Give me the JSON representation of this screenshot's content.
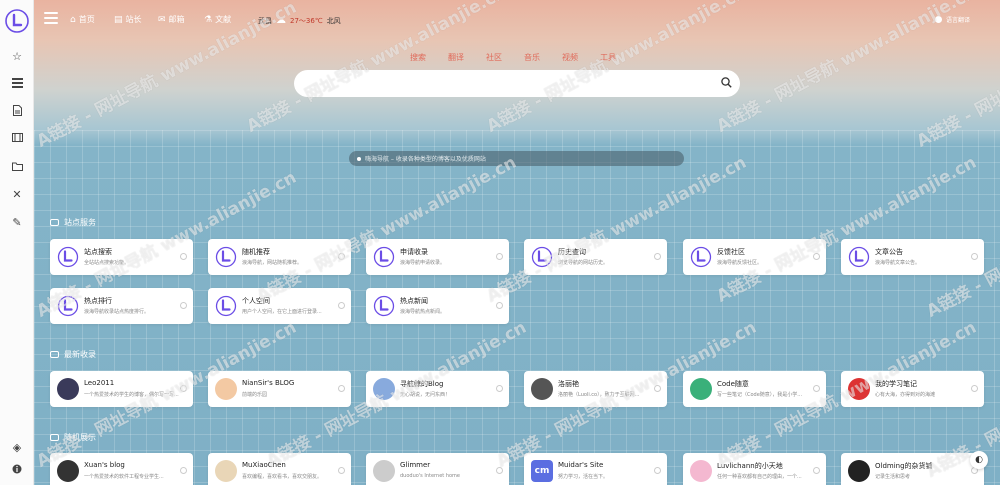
{
  "nav": {
    "items": [
      {
        "label": "首页",
        "icon": "home-icon"
      },
      {
        "label": "站长",
        "icon": "book-icon"
      },
      {
        "label": "邮箱",
        "icon": "mail-icon"
      },
      {
        "label": "文献",
        "icon": "flask-icon"
      }
    ],
    "weather": {
      "city": "武昌",
      "temp": "27～36℃",
      "wind": "北风"
    },
    "lang_label": "语言翻译"
  },
  "search": {
    "tabs": [
      "搜索",
      "翻译",
      "社区",
      "音乐",
      "视频",
      "工具"
    ],
    "placeholder": ""
  },
  "notice": "嗨海导航 – 收录各种类型的博客以及优质网站",
  "sections": [
    {
      "title": "站点服务",
      "cards": [
        {
          "title": "站点搜索",
          "desc": "全站站点搜索功能。"
        },
        {
          "title": "随机推荐",
          "desc": "浪海导航，网站随机推荐。"
        },
        {
          "title": "申请收录",
          "desc": "浪海导航申请收录。"
        },
        {
          "title": "历史查询",
          "desc": "浏览导航的网站历史。"
        },
        {
          "title": "反馈社区",
          "desc": "浪海导航反馈社区。"
        },
        {
          "title": "文章公告",
          "desc": "浪海导航文章公告。"
        },
        {
          "title": "热点排行",
          "desc": "浪海导航收录站点热度排行。"
        },
        {
          "title": "个人空间",
          "desc": "用户个人空间，在它上面进行登录..."
        },
        {
          "title": "热点新闻",
          "desc": "浪海导航热点新闻。"
        }
      ]
    },
    {
      "title": "最新收录",
      "cards": [
        {
          "title": "Leo2011",
          "desc": "一个热爱技术的学生的博客，偶尔写一写..."
        },
        {
          "title": "NianSir's BLOG",
          "desc": "前端的乐园"
        },
        {
          "title": "寻舷鲸的Blog",
          "desc": "无心胡说，无问东西！"
        },
        {
          "title": "洛丽艳",
          "desc": "洛丽艳（Luoli.co），致力于互联网..."
        },
        {
          "title": "Code随意",
          "desc": "写一些笔记（Code随意），我是小学..."
        },
        {
          "title": "我的学习笔记",
          "desc": "心有大海，亦得到对的海滩"
        }
      ]
    },
    {
      "title": "随机展示",
      "cards": [
        {
          "title": "Xuan's blog",
          "desc": "一个热爱技术的软件工程专业学生..."
        },
        {
          "title": "MuXiaoChen",
          "desc": "喜欢编程，喜欢看书，喜欢交朋友。"
        },
        {
          "title": "Glimmer",
          "desc": "duoduo's Internet home"
        },
        {
          "title": "Muidar's Site",
          "desc": "努力学习，活在当下。"
        },
        {
          "title": "Luvlichann的小天地",
          "desc": "任何一种喜欢都有自己的理由，一个..."
        },
        {
          "title": "Oldming的杂货铺",
          "desc": "记录生活和思考"
        }
      ]
    }
  ],
  "watermark": "A链接 - 网址导航 www.alianjie.cn",
  "colors": {
    "accent": "#6b4de6",
    "tab_text": "#e06a5a",
    "bg": "#7fb1c6"
  }
}
